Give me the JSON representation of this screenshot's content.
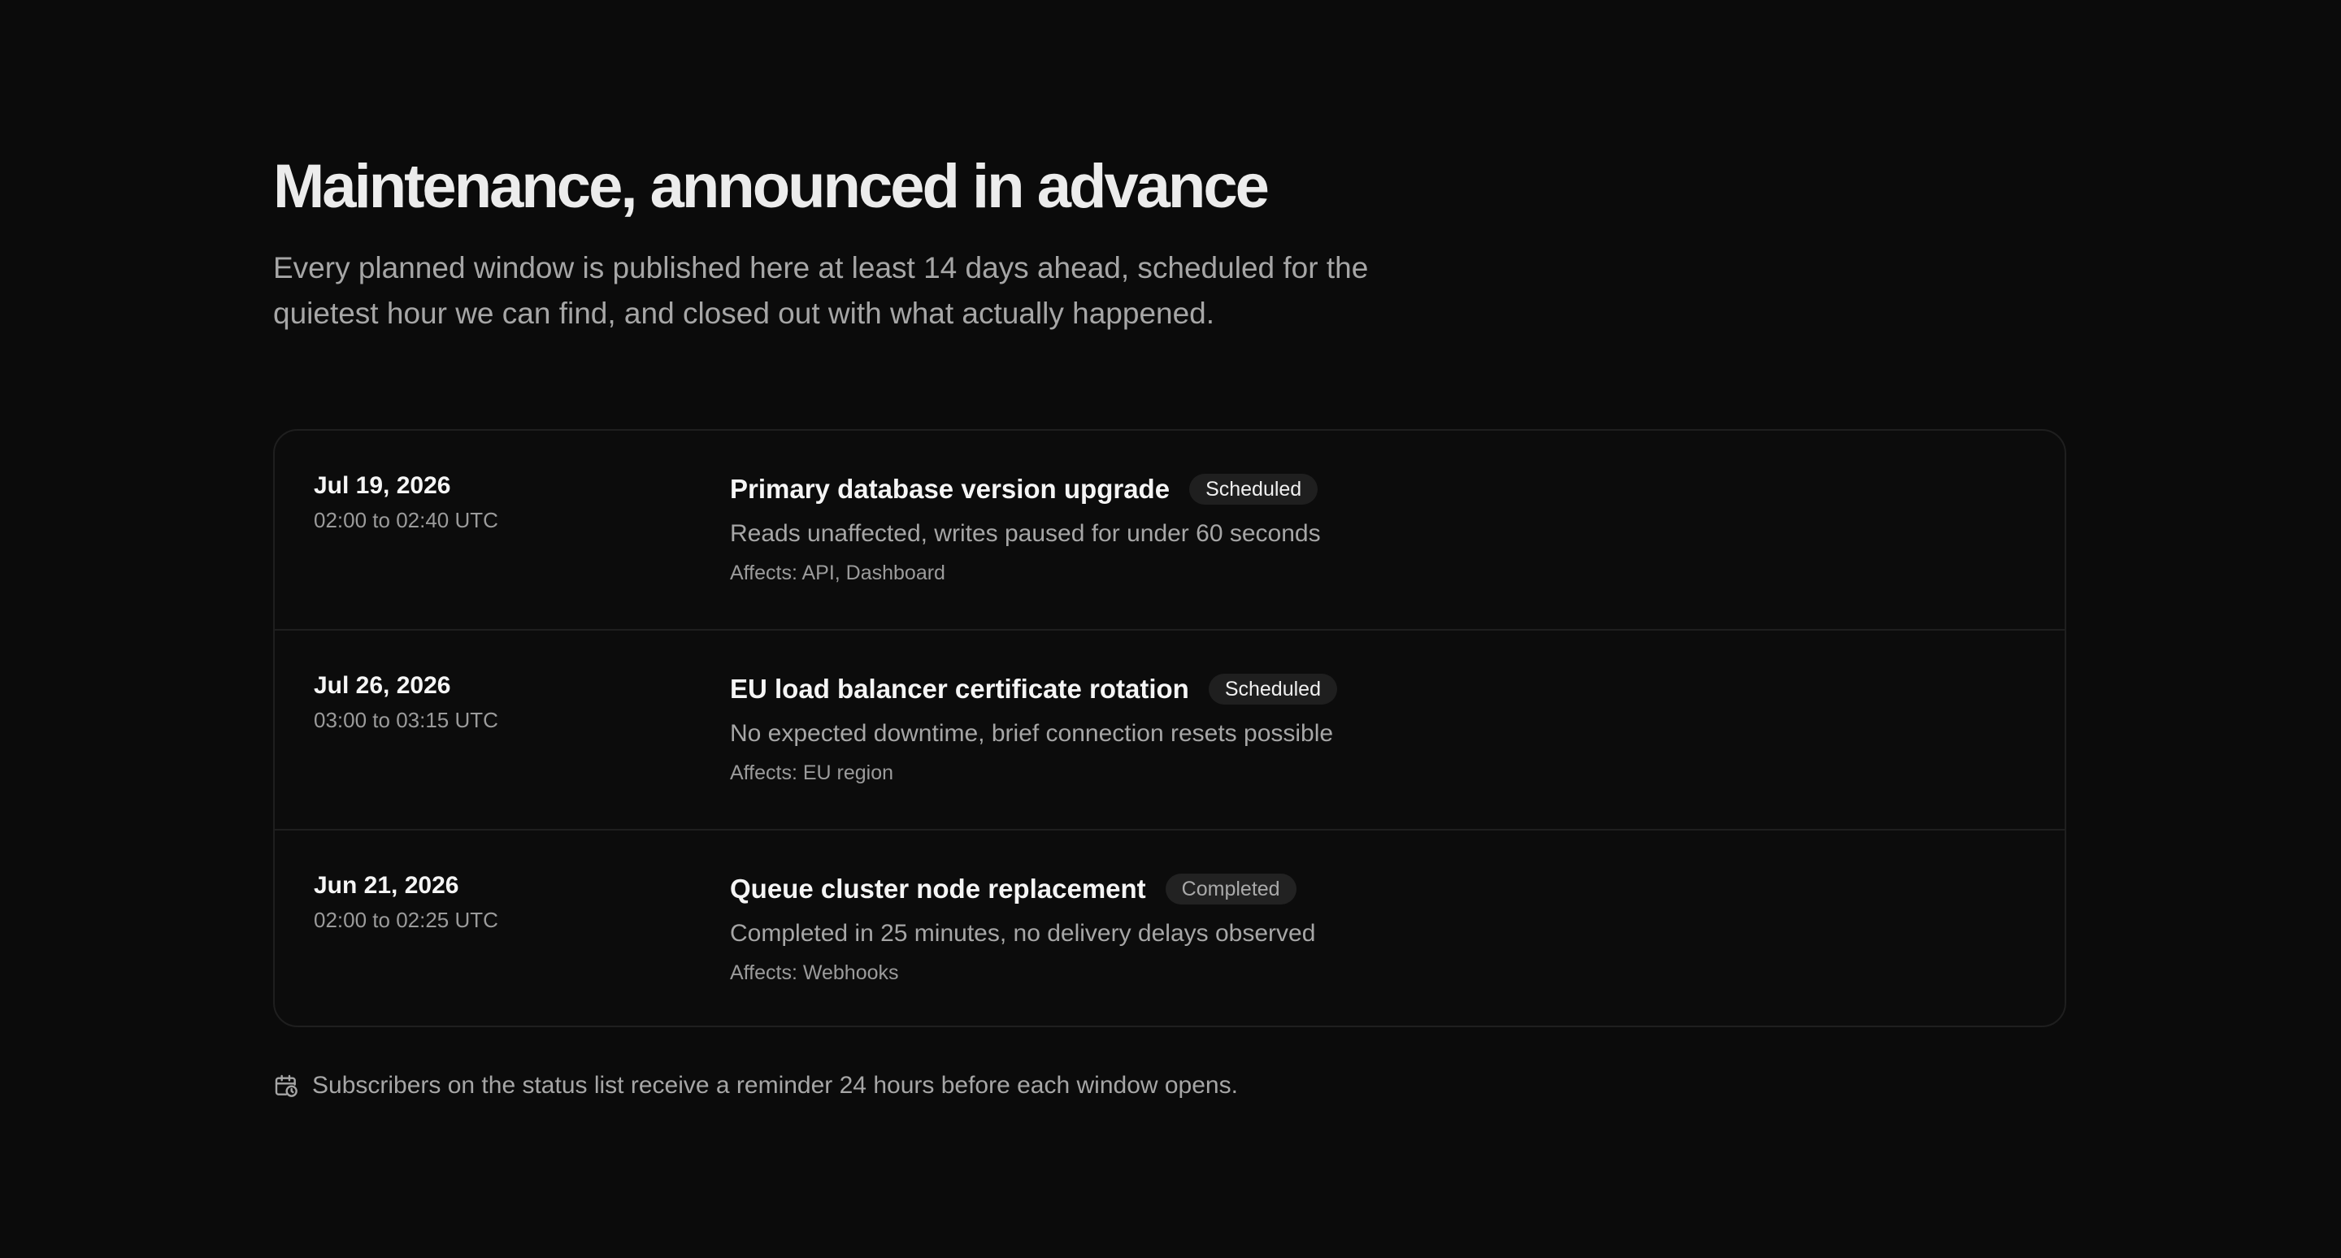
{
  "header": {
    "title": "Maintenance, announced in advance",
    "subtitle": "Every planned window is published here at least 14 days ahead, scheduled for the quietest hour we can find, and closed out with what actually happened."
  },
  "maintenance": [
    {
      "date": "Jul 19, 2026",
      "time": "02:00 to 02:40 UTC",
      "title": "Primary database version upgrade",
      "status": "Scheduled",
      "description": "Reads unaffected, writes paused for under 60 seconds",
      "affects": "Affects: API, Dashboard"
    },
    {
      "date": "Jul 26, 2026",
      "time": "03:00 to 03:15 UTC",
      "title": "EU load balancer certificate rotation",
      "status": "Scheduled",
      "description": "No expected downtime, brief connection resets possible",
      "affects": "Affects: EU region"
    },
    {
      "date": "Jun 21, 2026",
      "time": "02:00 to 02:25 UTC",
      "title": "Queue cluster node replacement",
      "status": "Completed",
      "description": "Completed in 25 minutes, no delivery delays observed",
      "affects": "Affects: Webhooks"
    }
  ],
  "footnote": {
    "icon": "calendar-clock-icon",
    "text": "Subscribers on the status list receive a reminder 24 hours before each window opens."
  },
  "colors": {
    "background": "#0b0b0b",
    "border": "#1f1f1f",
    "text_primary": "#f5f5f5",
    "text_muted": "#a6a6a6",
    "badge_background": "#1f1f1f"
  }
}
